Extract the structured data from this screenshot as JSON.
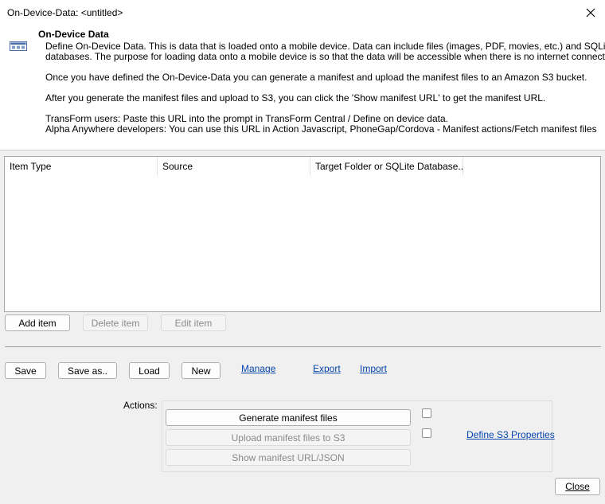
{
  "window": {
    "title": "On-Device-Data: <untitled>"
  },
  "info": {
    "heading": "On-Device Data",
    "icon": "data-grid-icon",
    "paragraph1_line1": "Define On-Device Data. This is data that is loaded onto a mobile device. Data can include files (images, PDF, movies, etc.) and SQLite",
    "paragraph1_line2": "databases. The purpose for loading data onto a mobile device is so that the data will be accessible when there is no internet connection.",
    "paragraph2": "Once you have defined the On-Device-Data you can generate a manifest and upload the manifest files to an Amazon S3 bucket.",
    "paragraph3": "After you generate the manifest files and upload to S3, you can click the 'Show manifest URL' to get the manifest URL.",
    "paragraph4_line1": "TransForm users: Paste this URL into the prompt in TransForm Central / Define on device data.",
    "paragraph4_line2": "Alpha Anywhere developers: You can use this URL in Action Javascript, PhoneGap/Cordova - Manifest actions/Fetch manifest files"
  },
  "list": {
    "columns": [
      "Item Type",
      "Source",
      "Target Folder or SQLite Database..."
    ]
  },
  "item_buttons": {
    "add": "Add item",
    "delete": "Delete item",
    "edit": "Edit item"
  },
  "file_buttons": {
    "save": "Save",
    "save_as": "Save as..",
    "load": "Load",
    "new": "New"
  },
  "links": {
    "manage": "Manage",
    "export": "Export",
    "import": "Import",
    "define_s3": "Define S3 Properties"
  },
  "actions": {
    "label": "Actions:",
    "generate": "Generate manifest files",
    "upload": "Upload manifest files to S3",
    "show": "Show manifest URL/JSON"
  },
  "footer": {
    "close": "Close"
  },
  "colors": {
    "link": "#0645ad",
    "background": "#f0f0f0"
  }
}
